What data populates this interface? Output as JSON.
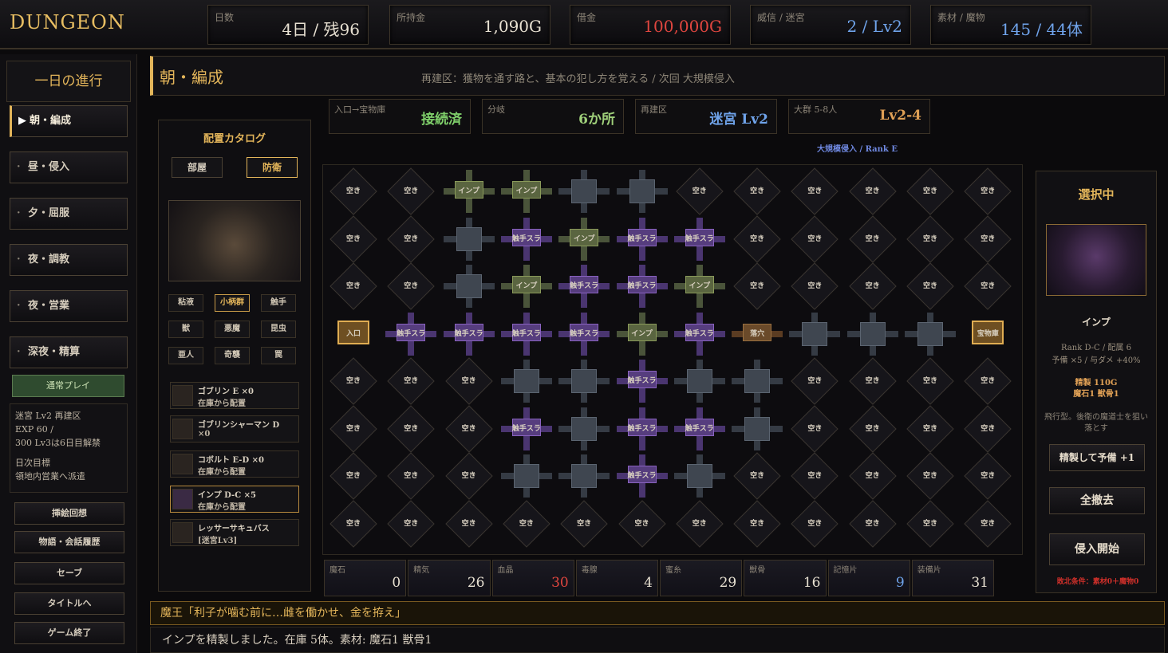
{
  "app": {
    "logo": "DUNGEON"
  },
  "stats": [
    {
      "label": "日数",
      "value": "4日 / 残96",
      "color": "normal"
    },
    {
      "label": "所持金",
      "value": "1,090G",
      "color": "normal"
    },
    {
      "label": "借金",
      "value": "100,000G",
      "color": "red"
    },
    {
      "label": "威信 / 迷宮",
      "value": "2 / Lv2",
      "color": "blue"
    },
    {
      "label": "素材 / 魔物",
      "value": "145 / 44体",
      "color": "blue"
    }
  ],
  "nav": {
    "header": "一日の進行",
    "items": [
      {
        "label": "朝・編成",
        "active": true
      },
      {
        "label": "昼・侵入",
        "active": false
      },
      {
        "label": "夕・屈服",
        "active": false
      },
      {
        "label": "夜・調教",
        "active": false
      },
      {
        "label": "夜・営業",
        "active": false
      },
      {
        "label": "深夜・精算",
        "active": false
      }
    ],
    "mode_button": "通常プレイ",
    "info": {
      "line1": "迷宮 Lv2 再建区",
      "line2": "EXP 60 /",
      "line3": "300 Lv3は6日目解禁",
      "line4": "日次目標",
      "line5": "領地内営業へ派遣"
    },
    "system": [
      "挿絵回想",
      "物語・会話履歴",
      "セーブ",
      "タイトルへ",
      "ゲーム終了"
    ]
  },
  "phase": {
    "title": "朝・編成",
    "subtitle": "再建区：獲物を通す路と、基本の犯し方を覚える / 次回 大規模侵入"
  },
  "catalog": {
    "title": "配置カタログ",
    "tabs": [
      "部屋",
      "防衛"
    ],
    "filters": [
      "粘液",
      "小柄群",
      "触手",
      "獣",
      "悪魔",
      "昆虫",
      "亜人",
      "奇襲",
      "罠"
    ],
    "items": [
      {
        "name": "ゴブリン E ×0",
        "sub": "在庫から配置"
      },
      {
        "name": "ゴブリンシャーマン D",
        "sub": "×0"
      },
      {
        "name": "コボルト E-D ×0",
        "sub": "在庫から配置"
      },
      {
        "name": "インプ D-C ×5",
        "sub": "在庫から配置"
      },
      {
        "name": "レッサーサキュバス",
        "sub": "[迷宮Lv3]"
      }
    ]
  },
  "routes": [
    {
      "label": "入口→宝物庫",
      "value": "接続済",
      "color": "#7fcf6a"
    },
    {
      "label": "分岐",
      "value": "6か所",
      "color": "#9fd07a"
    },
    {
      "label": "再建区",
      "value": "迷宮 Lv2",
      "color": "#6fa3ea"
    },
    {
      "label": "大群 5-8人",
      "value": "Lv2-4",
      "color": "#e0a055"
    }
  ],
  "rank_line": "大規模侵入 / Rank E",
  "grid": {
    "empty_label": "空き",
    "rows": [
      [
        "e",
        "e",
        "i",
        "i",
        "r",
        "r",
        "e",
        "e",
        "e",
        "e",
        "e",
        "e"
      ],
      [
        "e",
        "e",
        "r",
        "t",
        "i",
        "t",
        "t",
        "e",
        "e",
        "e",
        "e",
        "e"
      ],
      [
        "e",
        "e",
        "r",
        "i",
        "t",
        "t",
        "i",
        "e",
        "e",
        "e",
        "e",
        "e"
      ],
      [
        "ent",
        "t",
        "t",
        "t",
        "t",
        "i",
        "t",
        "trap",
        "r",
        "r",
        "r",
        "treas"
      ],
      [
        "e",
        "e",
        "e",
        "r",
        "r",
        "t",
        "r",
        "r",
        "e",
        "e",
        "e",
        "e"
      ],
      [
        "e",
        "e",
        "e",
        "t",
        "r",
        "t",
        "t",
        "r",
        "e",
        "e",
        "e",
        "e"
      ],
      [
        "e",
        "e",
        "e",
        "r",
        "r",
        "t",
        "r",
        "e",
        "e",
        "e",
        "e",
        "e"
      ],
      [
        "e",
        "e",
        "e",
        "e",
        "e",
        "e",
        "e",
        "e",
        "e",
        "e",
        "e",
        "e"
      ]
    ],
    "labels": {
      "i": "インプ",
      "t": "触手スラ",
      "ent": "入口",
      "treas": "宝物庫",
      "trap": "落穴"
    }
  },
  "resources": [
    {
      "label": "魔石",
      "value": "0"
    },
    {
      "label": "精気",
      "value": "26"
    },
    {
      "label": "血晶",
      "value": "30",
      "color": "#e0463f"
    },
    {
      "label": "毒腺",
      "value": "4"
    },
    {
      "label": "蜜糸",
      "value": "29"
    },
    {
      "label": "獣骨",
      "value": "16"
    },
    {
      "label": "記憶片",
      "value": "9",
      "color": "#6fa3ea"
    },
    {
      "label": "装備片",
      "value": "31"
    }
  ],
  "selected": {
    "title": "選択中",
    "name": "インプ",
    "rank": "Rank D-C / 配属 6",
    "stock": "予備 ×5 / 与ダメ +40%",
    "cost1": "精製 110G",
    "cost2": "魔石1 獣骨1",
    "desc": "飛行型。後衛の魔道士を狙い落とす",
    "btn_refine": "精製して予備 +1",
    "btn_clear": "全撤去",
    "btn_start": "侵入開始",
    "defeat": "敗北条件：素材0＋魔物0"
  },
  "dialog": "魔王「利子が噛む前に…雌を働かせ、金を拵え」",
  "log": "インプを精製しました。在庫 5体。素材: 魔石1 獣骨1"
}
